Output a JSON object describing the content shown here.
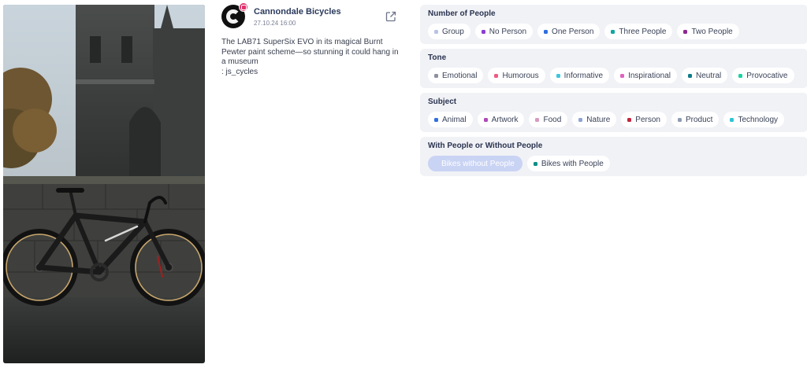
{
  "post": {
    "author": "Cannondale Bicycles",
    "timestamp": "27.10.24 16:00",
    "platform_icon": "instagram-icon",
    "caption_lines": [
      "The LAB71 SuperSix EVO in its magical Burnt Pewter paint scheme—so stunning it could hang in a museum",
      ": js_cycles"
    ],
    "photo_alt": "Black road bike leaning on a stone wall in front of a gothic church"
  },
  "groups": [
    {
      "title": "Number of People",
      "chips": [
        {
          "label": "Group",
          "color": "#b9c3e6",
          "selected": false
        },
        {
          "label": "No Person",
          "color": "#8a3fd1",
          "selected": false
        },
        {
          "label": "One Person",
          "color": "#2f6fe0",
          "selected": false
        },
        {
          "label": "Three People",
          "color": "#10a6a6",
          "selected": false
        },
        {
          "label": "Two People",
          "color": "#8b2a8f",
          "selected": false
        }
      ]
    },
    {
      "title": "Tone",
      "chips": [
        {
          "label": "Emotional",
          "color": "#8d919c",
          "selected": false
        },
        {
          "label": "Humorous",
          "color": "#ef5c82",
          "selected": false
        },
        {
          "label": "Informative",
          "color": "#3ec6dc",
          "selected": false
        },
        {
          "label": "Inspirational",
          "color": "#e062c0",
          "selected": false
        },
        {
          "label": "Neutral",
          "color": "#0e7c8a",
          "selected": false
        },
        {
          "label": "Provocative",
          "color": "#19d3a2",
          "selected": false
        }
      ]
    },
    {
      "title": "Subject",
      "chips": [
        {
          "label": "Animal",
          "color": "#2f6fe0",
          "selected": false
        },
        {
          "label": "Artwork",
          "color": "#b04ab8",
          "selected": false
        },
        {
          "label": "Food",
          "color": "#d99ac0",
          "selected": false
        },
        {
          "label": "Nature",
          "color": "#8ea3d8",
          "selected": false
        },
        {
          "label": "Person",
          "color": "#c2263f",
          "selected": false
        },
        {
          "label": "Product",
          "color": "#8f9bb3",
          "selected": false
        },
        {
          "label": "Technology",
          "color": "#2ec4d6",
          "selected": false
        }
      ]
    },
    {
      "title": "With People or Without People",
      "chips": [
        {
          "label": "Bikes without People",
          "color": "#c9d3f3",
          "selected": true
        },
        {
          "label": "Bikes with People",
          "color": "#0f8f86",
          "selected": false
        }
      ]
    }
  ]
}
